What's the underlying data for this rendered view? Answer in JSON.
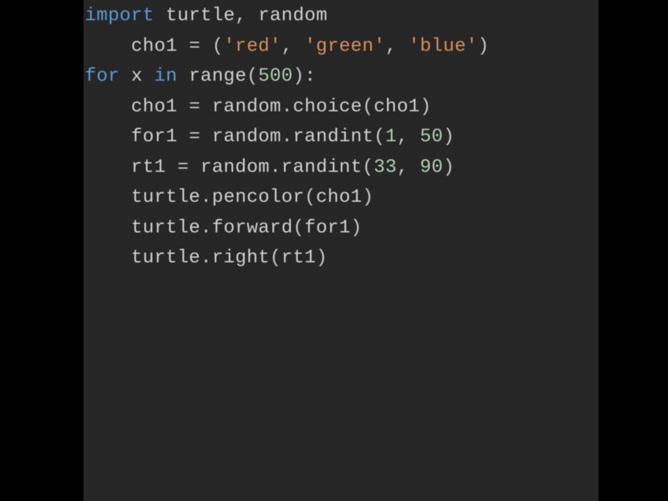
{
  "code": {
    "lang": "python",
    "tokens": [
      [
        {
          "t": "kw",
          "v": "import"
        },
        {
          "t": "plain",
          "v": " turtle"
        },
        {
          "t": "punct",
          "v": ", "
        },
        {
          "t": "plain",
          "v": "random"
        }
      ],
      [
        {
          "t": "plain",
          "v": "    cho1 "
        },
        {
          "t": "punct",
          "v": "= ("
        },
        {
          "t": "str",
          "v": "'red'"
        },
        {
          "t": "punct",
          "v": ", "
        },
        {
          "t": "str",
          "v": "'green'"
        },
        {
          "t": "punct",
          "v": ", "
        },
        {
          "t": "str",
          "v": "'blue'"
        },
        {
          "t": "punct",
          "v": ")"
        }
      ],
      [
        {
          "t": "kw",
          "v": "for"
        },
        {
          "t": "plain",
          "v": " x "
        },
        {
          "t": "kw",
          "v": "in"
        },
        {
          "t": "plain",
          "v": " range"
        },
        {
          "t": "punct",
          "v": "("
        },
        {
          "t": "num",
          "v": "500"
        },
        {
          "t": "punct",
          "v": "):"
        }
      ],
      [
        {
          "t": "plain",
          "v": "    cho1 "
        },
        {
          "t": "punct",
          "v": "= "
        },
        {
          "t": "plain",
          "v": "random"
        },
        {
          "t": "punct",
          "v": "."
        },
        {
          "t": "plain",
          "v": "choice"
        },
        {
          "t": "punct",
          "v": "("
        },
        {
          "t": "plain",
          "v": "cho1"
        },
        {
          "t": "punct",
          "v": ")"
        }
      ],
      [
        {
          "t": "plain",
          "v": "    for1 "
        },
        {
          "t": "punct",
          "v": "= "
        },
        {
          "t": "plain",
          "v": "random"
        },
        {
          "t": "punct",
          "v": "."
        },
        {
          "t": "plain",
          "v": "randint"
        },
        {
          "t": "punct",
          "v": "("
        },
        {
          "t": "num",
          "v": "1"
        },
        {
          "t": "punct",
          "v": ", "
        },
        {
          "t": "num",
          "v": "50"
        },
        {
          "t": "punct",
          "v": ")"
        }
      ],
      [
        {
          "t": "plain",
          "v": "    rt1 "
        },
        {
          "t": "punct",
          "v": "= "
        },
        {
          "t": "plain",
          "v": "random"
        },
        {
          "t": "punct",
          "v": "."
        },
        {
          "t": "plain",
          "v": "randint"
        },
        {
          "t": "punct",
          "v": "("
        },
        {
          "t": "num",
          "v": "33"
        },
        {
          "t": "punct",
          "v": ", "
        },
        {
          "t": "num",
          "v": "90"
        },
        {
          "t": "punct",
          "v": ")"
        }
      ],
      [
        {
          "t": "plain",
          "v": "    turtle"
        },
        {
          "t": "punct",
          "v": "."
        },
        {
          "t": "plain",
          "v": "pencolor"
        },
        {
          "t": "punct",
          "v": "("
        },
        {
          "t": "plain",
          "v": "cho1"
        },
        {
          "t": "punct",
          "v": ")"
        }
      ],
      [
        {
          "t": "plain",
          "v": "    turtle"
        },
        {
          "t": "punct",
          "v": "."
        },
        {
          "t": "plain",
          "v": "forward"
        },
        {
          "t": "punct",
          "v": "("
        },
        {
          "t": "plain",
          "v": "for1"
        },
        {
          "t": "punct",
          "v": ")"
        }
      ],
      [
        {
          "t": "plain",
          "v": "    turtle"
        },
        {
          "t": "punct",
          "v": "."
        },
        {
          "t": "plain",
          "v": "right"
        },
        {
          "t": "punct",
          "v": "("
        },
        {
          "t": "plain",
          "v": "rt1"
        },
        {
          "t": "punct",
          "v": ")"
        }
      ]
    ]
  }
}
